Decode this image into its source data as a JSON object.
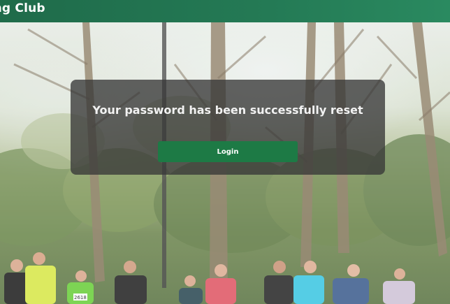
{
  "header": {
    "site_title": "nning Club"
  },
  "modal": {
    "message": "Your password has been successfully reset",
    "login_label": "Login"
  },
  "colors": {
    "header_green": "#247a55",
    "button_green": "#1d7a45",
    "modal_background": "rgba(55,55,55,0.78)"
  },
  "background": {
    "scene": "runners-in-park-photo",
    "bib_numbers": [
      "2618"
    ]
  }
}
